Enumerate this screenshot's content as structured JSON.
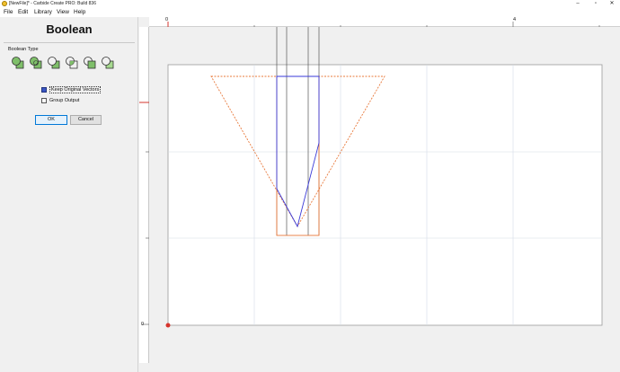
{
  "window": {
    "title": "[NewFile]* - Carbide Create PRO: Build 836",
    "minimize_glyph": "–",
    "maximize_glyph": "▫",
    "close_glyph": "✕"
  },
  "menu": {
    "file": "File",
    "edit": "Edit",
    "library": "Library",
    "view": "View",
    "help": "Help"
  },
  "panel": {
    "title": "Boolean",
    "boolean_type_label": "Boolean Type",
    "boolean_icons": [
      "union-icon",
      "weld-icon",
      "subtract-icon",
      "intersect-icon",
      "subtract-back-icon",
      "subtract-front-icon"
    ],
    "keep_original_label": "Keep Original Vectors",
    "keep_original_checked": true,
    "group_output_label": "Group Output",
    "group_output_checked": false,
    "ok_label": "OK",
    "cancel_label": "Cancel"
  },
  "rulers": {
    "top_labels": [
      "0",
      "4"
    ],
    "left_labels": [
      "0"
    ]
  },
  "colors": {
    "orange_vector": "#e8783a",
    "blue_vector": "#3a3ad8",
    "grid": "#d6dce6",
    "ruler_origin": "#d6342c",
    "icon_green": "#7fbf6a"
  }
}
